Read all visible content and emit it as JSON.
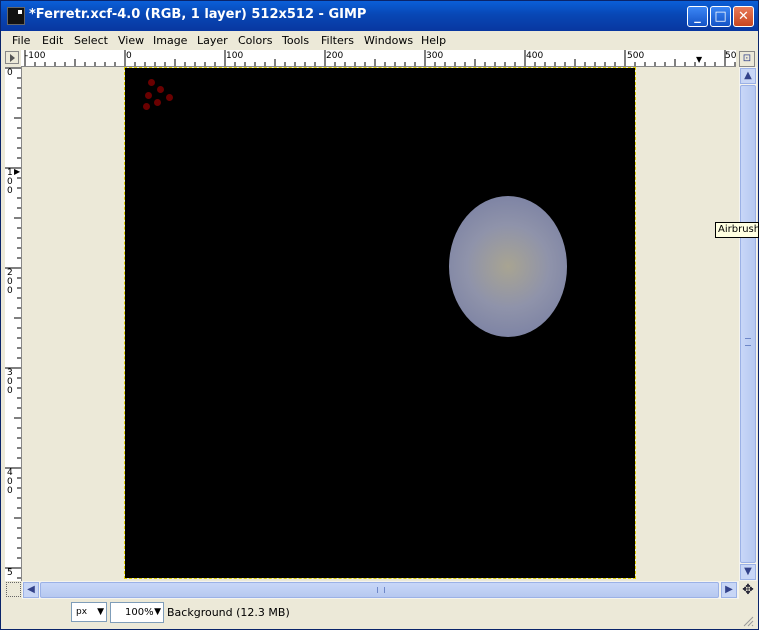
{
  "window": {
    "title": "*Ferretr.xcf-4.0 (RGB, 1 layer) 512x512 - GIMP",
    "buttons": {
      "minimize": "_",
      "maximize": "□",
      "close": "✕"
    }
  },
  "menubar": {
    "items": [
      {
        "label": "File"
      },
      {
        "label": "Edit"
      },
      {
        "label": "Select"
      },
      {
        "label": "View"
      },
      {
        "label": "Image"
      },
      {
        "label": "Layer"
      },
      {
        "label": "Colors"
      },
      {
        "label": "Tools"
      },
      {
        "label": "Filters"
      },
      {
        "label": "Windows"
      },
      {
        "label": "Help"
      }
    ]
  },
  "rulers": {
    "horizontal_labels": [
      "-100",
      "0",
      "100",
      "200",
      "300",
      "400",
      "500",
      "50"
    ],
    "vertical_labels": [
      "0",
      "100",
      "200",
      "300",
      "400",
      "5"
    ]
  },
  "canvas": {
    "image_background": "#000000",
    "selection_outline_color": "#e0d000",
    "red_dot_color": "#6a0000"
  },
  "statusbar": {
    "unit": "px",
    "zoom": "100%",
    "message": "Background (12.3 MB)"
  },
  "tooltip": {
    "text": "Airbrush"
  },
  "icons": {
    "navigate": "navigate-icon",
    "scroll_up": "scroll-up-arrow-icon",
    "scroll_down": "scroll-down-arrow-icon",
    "scroll_left": "scroll-left-arrow-icon",
    "scroll_right": "scroll-right-arrow-icon"
  }
}
